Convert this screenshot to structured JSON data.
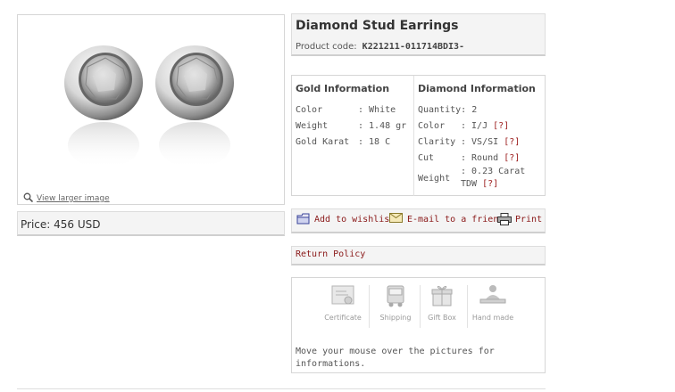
{
  "product": {
    "title": "Diamond Stud Earrings",
    "code_label": "Product code:",
    "code_value": "K221211-011714BDI3-"
  },
  "image": {
    "larger_link": "View larger image",
    "icon": "magnifier-icon"
  },
  "price": "Price: 456 USD",
  "gold": {
    "header": "Gold Information",
    "rows": [
      {
        "label": "Color",
        "value": ": White"
      },
      {
        "label": "Weight",
        "value": ": 1.48 gr"
      },
      {
        "label": "Gold Karat",
        "value": ": 18 C"
      }
    ]
  },
  "diamond": {
    "header": "Diamond Information",
    "quantity_label": "Quantity:",
    "quantity_value": "2",
    "color_label": "Color",
    "color_value": ": I/J",
    "clarity_label": "Clarity",
    "clarity_value": ": VS/SI",
    "cut_label": "Cut",
    "cut_value": ": Round",
    "weight_label": "Weight",
    "weight_value_1": ": 0.23 Carat",
    "weight_value_2": "TDW",
    "help": "[?]"
  },
  "actions": {
    "wishlist": "Add to wishlist",
    "email": "E-mail to a friend",
    "print": "Print"
  },
  "return_policy": "Return Policy",
  "features": {
    "items": [
      "Certificate",
      "Shipping",
      "Gift Box",
      "Hand made"
    ],
    "hint": "Move your mouse over the pictures for informations."
  },
  "colors": {
    "link_red": "#8a1818",
    "border": "#d6d6d6",
    "panel_gray": "#f4f4f4"
  }
}
